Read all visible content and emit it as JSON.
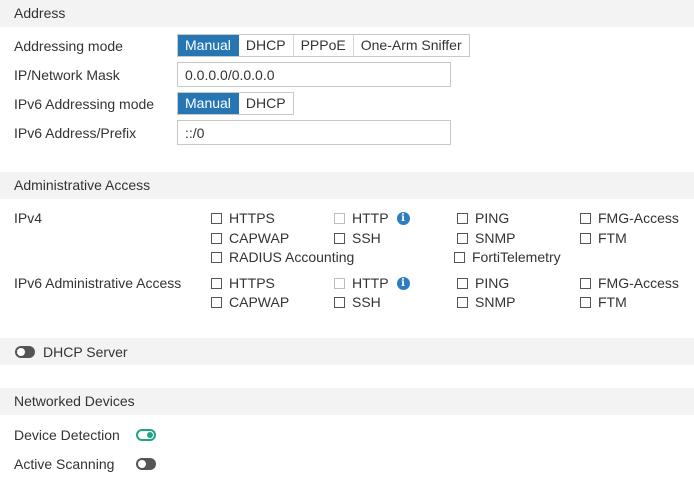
{
  "address": {
    "header": "Address",
    "addressing_mode": {
      "label": "Addressing mode",
      "options": [
        "Manual",
        "DHCP",
        "PPPoE",
        "One-Arm Sniffer"
      ],
      "selected": "Manual"
    },
    "ip_mask": {
      "label": "IP/Network Mask",
      "value": "0.0.0.0/0.0.0.0"
    },
    "ipv6_mode": {
      "label": "IPv6 Addressing mode",
      "options": [
        "Manual",
        "DHCP"
      ],
      "selected": "Manual"
    },
    "ipv6_prefix": {
      "label": "IPv6 Address/Prefix",
      "value": "::/0"
    }
  },
  "admin_access": {
    "header": "Administrative Access",
    "ipv4": {
      "label": "IPv4",
      "items": [
        "HTTPS",
        "HTTP",
        "PING",
        "FMG-Access",
        "CAPWAP",
        "SSH",
        "SNMP",
        "FTM",
        "RADIUS Accounting",
        "FortiTelemetry"
      ]
    },
    "ipv6": {
      "label": "IPv6 Administrative Access",
      "items": [
        "HTTPS",
        "HTTP",
        "PING",
        "FMG-Access",
        "CAPWAP",
        "SSH",
        "SNMP",
        "FTM"
      ]
    }
  },
  "dhcp_server": {
    "label": "DHCP Server",
    "enabled": false
  },
  "networked_devices": {
    "header": "Networked Devices",
    "device_detection": {
      "label": "Device Detection",
      "enabled": true
    },
    "active_scanning": {
      "label": "Active Scanning",
      "enabled": false
    }
  },
  "colors": {
    "accent": "#2676b4",
    "toggle_on": "#1fa583",
    "section_bg": "#f3f3f3"
  }
}
